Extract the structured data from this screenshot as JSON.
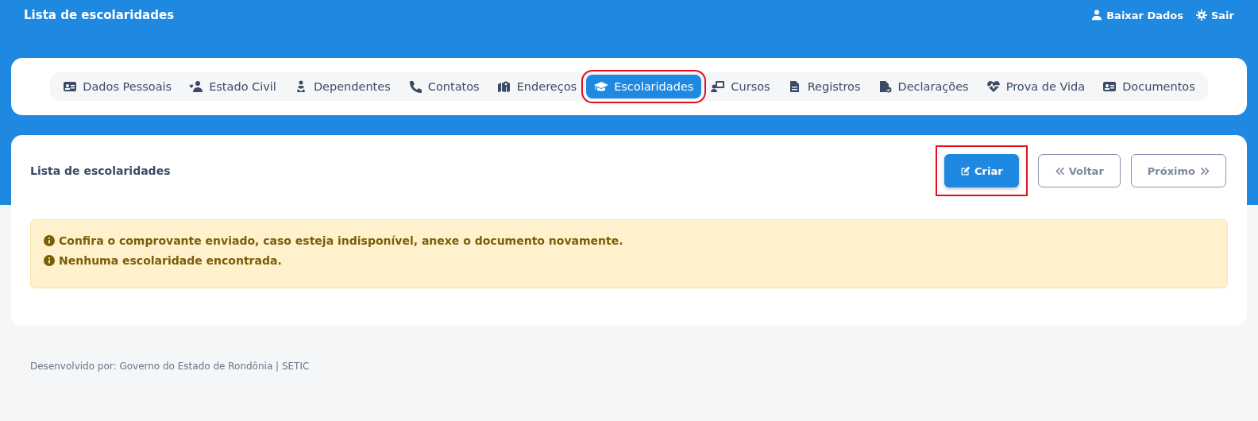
{
  "header": {
    "title": "Lista de escolaridades",
    "actions": [
      {
        "kind": "user",
        "label": "Baixar Dados"
      },
      {
        "kind": "gear",
        "label": "Sair"
      }
    ]
  },
  "tabs": [
    {
      "label": "Dados Pessoais",
      "selected": false,
      "highlighted": false
    },
    {
      "label": "Estado Civil",
      "selected": false,
      "highlighted": false
    },
    {
      "label": "Dependentes",
      "selected": false,
      "highlighted": false
    },
    {
      "label": "Contatos",
      "selected": false,
      "highlighted": false
    },
    {
      "label": "Endereços",
      "selected": false,
      "highlighted": false
    },
    {
      "label": "Escolaridades",
      "selected": true,
      "highlighted": true
    },
    {
      "label": "Cursos",
      "selected": false,
      "highlighted": false
    },
    {
      "label": "Registros",
      "selected": false,
      "highlighted": false
    },
    {
      "label": "Declarações",
      "selected": false,
      "highlighted": false
    },
    {
      "label": "Prova de Vida",
      "selected": false,
      "highlighted": false
    },
    {
      "label": "Documentos",
      "selected": false,
      "highlighted": false
    }
  ],
  "panel": {
    "title": "Lista de escolaridades",
    "buttons": [
      {
        "kind": "create",
        "label": "Criar",
        "highlighted": true
      },
      {
        "kind": "back",
        "label": "Voltar",
        "highlighted": false
      },
      {
        "kind": "next",
        "label": "Próximo",
        "highlighted": false
      }
    ],
    "alert": [
      "Confira o comprovante enviado, caso esteja indisponível, anexe o documento novamente.",
      "Nenhuma escolaridade encontrada."
    ]
  },
  "footer": "Desenvolvido por: Governo do Estado de Rondônia | SETIC"
}
